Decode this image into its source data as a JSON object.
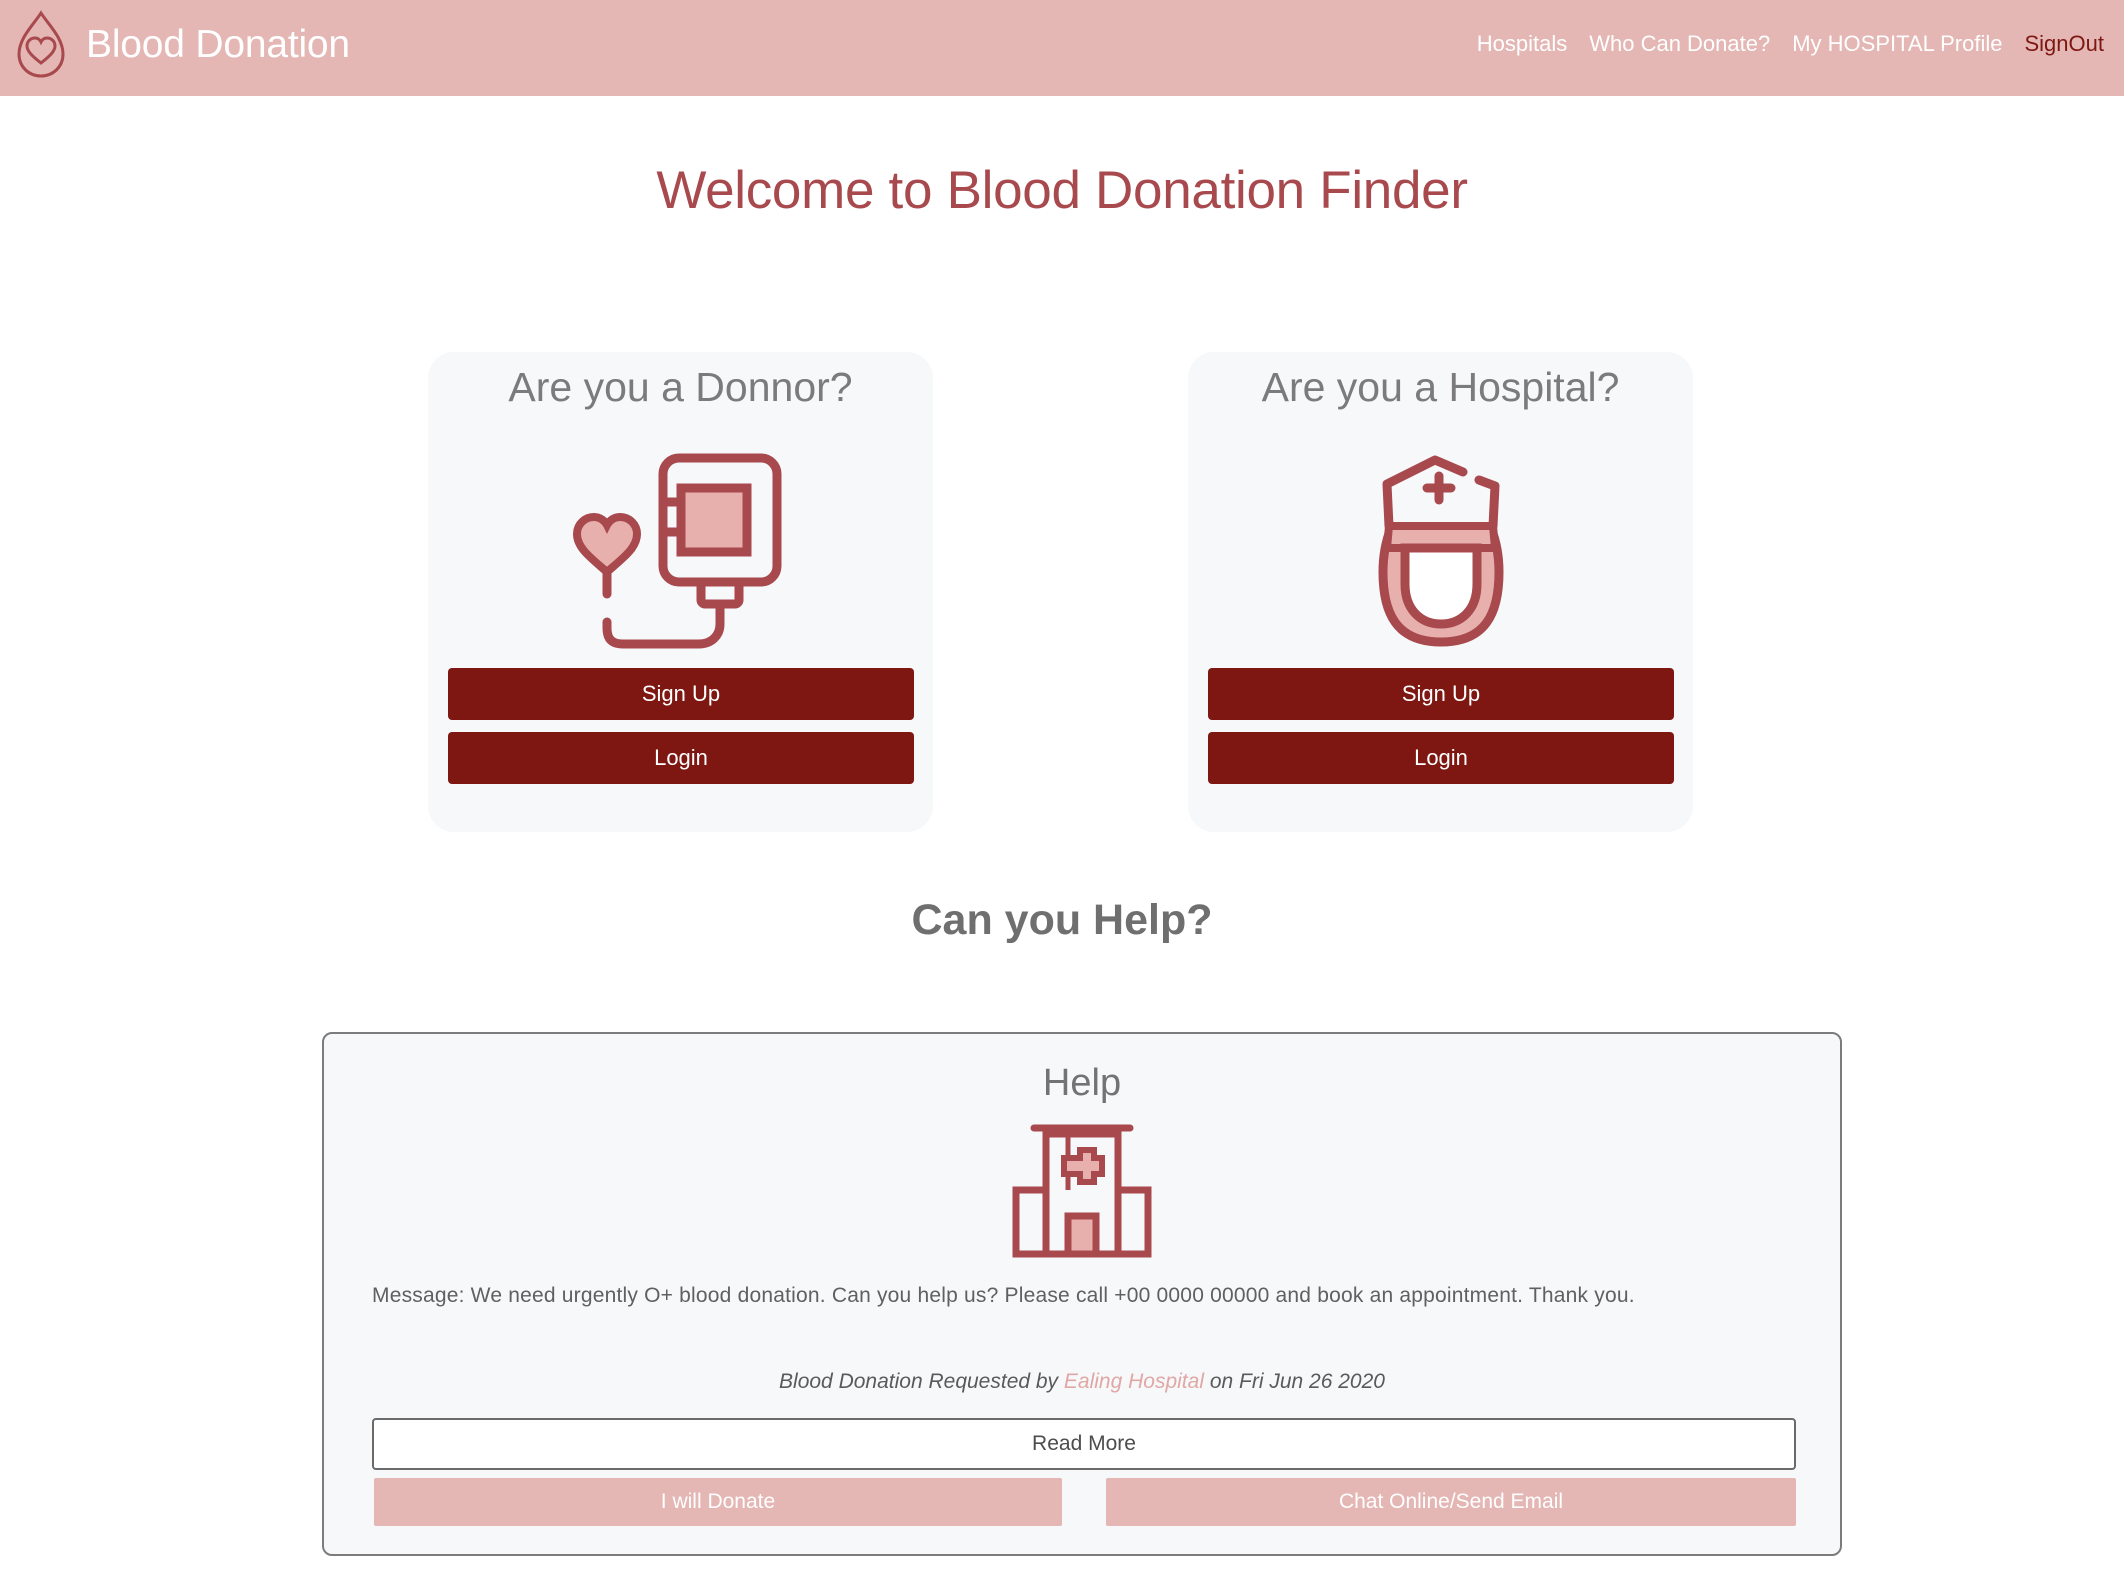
{
  "navbar": {
    "brand": "Blood Donation",
    "links": [
      {
        "label": "Hospitals"
      },
      {
        "label": "Who Can Donate?"
      },
      {
        "label": "My HOSPITAL Profile"
      },
      {
        "label": "SignOut"
      }
    ]
  },
  "welcome_title": "Welcome to Blood Donation Finder",
  "donor_card": {
    "title": "Are you a Donnor?",
    "icon": "blood-bag-icon",
    "signup_label": "Sign Up",
    "login_label": "Login"
  },
  "hospital_card": {
    "title": "Are you a Hospital?",
    "icon": "nurse-icon",
    "signup_label": "Sign Up",
    "login_label": "Login"
  },
  "help_section": {
    "heading": "Can you Help?",
    "panel": {
      "title": "Help",
      "icon": "hospital-building-icon",
      "message": "Message: We need urgently O+ blood donation. Can you help us? Please call +00 0000 00000 and book an appointment. Thank you.",
      "byline_prefix": "Blood Donation Requested by",
      "hospital_name": "Ealing Hospital",
      "byline_suffix": "on Fri Jun 26 2020",
      "read_more_label": "Read More",
      "donate_label": "I will Donate",
      "chat_label": "Chat Online/Send Email"
    }
  },
  "colors": {
    "navbar_bg": "#e4b6b4",
    "accent_dark": "#7e1712",
    "heading_red": "#a8494e",
    "icon_stroke": "#a8494e",
    "icon_fill": "#e7b0ad"
  }
}
